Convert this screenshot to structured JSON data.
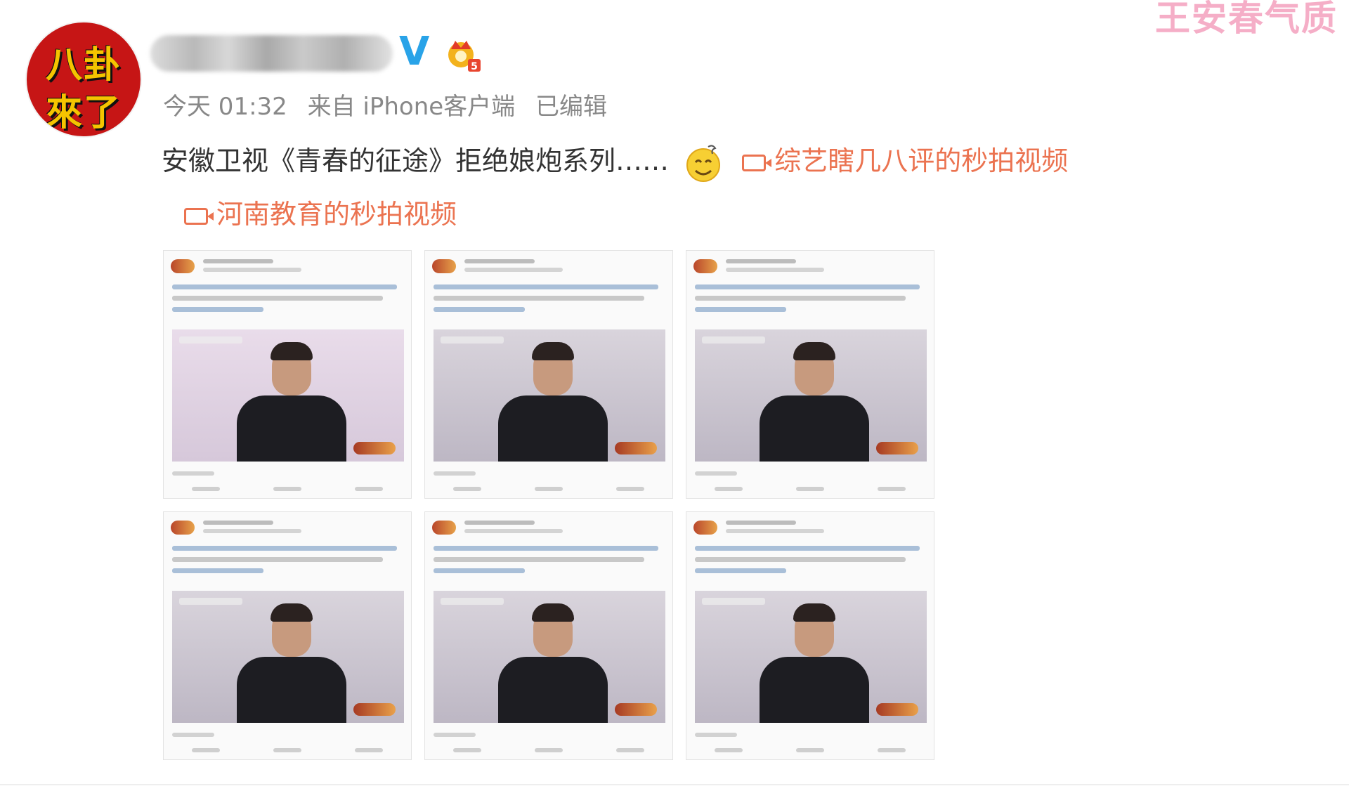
{
  "avatar": {
    "line1": "八卦",
    "line2": "來了"
  },
  "post": {
    "verified_glyph": "V",
    "meta": {
      "time": "今天 01:32",
      "source": "来自 iPhone客户端",
      "edited": "已编辑"
    },
    "text": "安徽卫视《青春的征途》拒绝娘炮系列……",
    "video_link_1": "综艺瞎几八评的秒拍视频",
    "video_link_2": "河南教育的秒拍视频",
    "icons": {
      "verified": "verified-v-icon",
      "member": "crown-badge-icon",
      "emoji": "dizzy-smile-emoji-icon",
      "video": "video-camera-icon"
    },
    "colors": {
      "link": "#eb7350",
      "verified": "#29a3e8",
      "meta": "#888888"
    }
  },
  "watermark": "王安春气质",
  "thumbnails": [
    {
      "id": 1,
      "bg": "pink"
    },
    {
      "id": 2,
      "bg": "gray"
    },
    {
      "id": 3,
      "bg": "gray"
    },
    {
      "id": 4,
      "bg": "gray"
    },
    {
      "id": 5,
      "bg": "gray"
    },
    {
      "id": 6,
      "bg": "gray"
    }
  ]
}
